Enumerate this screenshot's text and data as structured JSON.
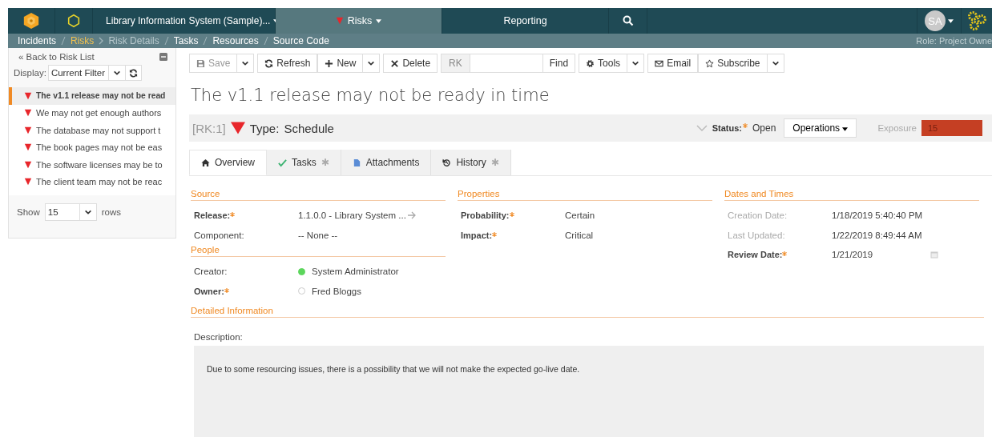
{
  "navbar": {
    "project": "Library Information System (Sample)...",
    "items": [
      {
        "label": "Risks",
        "selected": true,
        "kind": "artifact"
      },
      {
        "label": "Reporting",
        "selected": false,
        "kind": "plain"
      },
      {
        "selected": false,
        "kind": "search"
      }
    ],
    "avatar": "SA"
  },
  "subnav": {
    "items": [
      {
        "label": "Incidents",
        "kind": "link"
      },
      {
        "label": "Risks",
        "kind": "current"
      },
      {
        "label": "Risk Details",
        "kind": "disabled"
      },
      {
        "label": "Tasks",
        "kind": "link"
      },
      {
        "label": "Resources",
        "kind": "link"
      },
      {
        "label": "Source Code",
        "kind": "link"
      }
    ],
    "role": "Role: Project Owne"
  },
  "sidebar": {
    "back": "« Back to Risk List",
    "display_label": "Display:",
    "display_value": "Current Filter",
    "items": [
      {
        "label": "The v1.1 release may not be read",
        "selected": true
      },
      {
        "label": "We may not get enough authors",
        "selected": false
      },
      {
        "label": "The database may not support t",
        "selected": false
      },
      {
        "label": "The book pages may not be eas",
        "selected": false
      },
      {
        "label": "The software licenses may be to",
        "selected": false
      },
      {
        "label": "The client team may not be reac",
        "selected": false
      }
    ],
    "show_label": "Show",
    "show_value": "15",
    "rows_label": "rows"
  },
  "toolbar": [
    {
      "label": "Save",
      "disabled": true,
      "dropdown": true
    },
    {
      "label": "Refresh",
      "disabled": false,
      "dropdown": false
    },
    {
      "label": "New",
      "disabled": false,
      "dropdown": true
    },
    {
      "label": "Delete",
      "disabled": false,
      "dropdown": false
    }
  ],
  "find": {
    "prefix": "RK",
    "button": "Find"
  },
  "toolbar2": [
    {
      "label": "Tools",
      "disabled": false,
      "dropdown": true
    },
    {
      "label": "Email",
      "disabled": false,
      "dropdown": false
    },
    {
      "label": "Subscribe",
      "disabled": false,
      "dropdown": true
    }
  ],
  "title": "The v1.1 release may not be ready in time",
  "header": {
    "id": "[RK:1]",
    "type_label": "Type:",
    "type_value": "Schedule",
    "status_label": "Status:",
    "status_value": "Open",
    "operations": "Operations",
    "exposure_label": "Exposure",
    "exposure_value": "15"
  },
  "tabs": [
    {
      "label": "Overview",
      "selected": true
    },
    {
      "label": "Tasks",
      "selected": false,
      "badge": "✱"
    },
    {
      "label": "Attachments",
      "selected": false
    },
    {
      "label": "History",
      "selected": false,
      "badge": "✱"
    }
  ],
  "columns": [
    {
      "sections": [
        {
          "title": "Source",
          "fields": [
            {
              "label": "Release:",
              "value": "1.1.0.0 - Library System ...",
              "required": true,
              "disabled": false,
              "kind": "link"
            },
            {
              "label": "Component:",
              "value": "-- None --",
              "required": false,
              "disabled": false,
              "kind": "text"
            }
          ]
        },
        {
          "title": "People",
          "fields": [
            {
              "label": "Creator:",
              "value": "System Administrator",
              "required": false,
              "disabled": false,
              "kind": "user",
              "online": true
            },
            {
              "label": "Owner:",
              "value": "Fred Bloggs",
              "required": true,
              "disabled": false,
              "kind": "user",
              "online": false
            }
          ]
        }
      ]
    },
    {
      "sections": [
        {
          "title": "Properties",
          "fields": [
            {
              "label": "Probability:",
              "value": "Certain",
              "required": true,
              "disabled": false,
              "kind": "text"
            },
            {
              "label": "Impact:",
              "value": "Critical",
              "required": true,
              "disabled": false,
              "kind": "text"
            }
          ]
        }
      ]
    },
    {
      "sections": [
        {
          "title": "Dates and Times",
          "fields": [
            {
              "label": "Creation Date:",
              "value": "1/18/2019 5:40:40 PM",
              "required": false,
              "disabled": true,
              "kind": "text"
            },
            {
              "label": "Last Updated:",
              "value": "1/22/2019 8:49:44 AM",
              "required": false,
              "disabled": true,
              "kind": "text"
            },
            {
              "label": "Review Date:",
              "value": "1/21/2019",
              "required": true,
              "disabled": false,
              "kind": "date"
            }
          ]
        }
      ]
    }
  ],
  "detail": {
    "title": "Detailed Information",
    "description_label": "Description:",
    "description": "Due to some resourcing issues, there is a possibility that we will not make the expected go-live date."
  }
}
